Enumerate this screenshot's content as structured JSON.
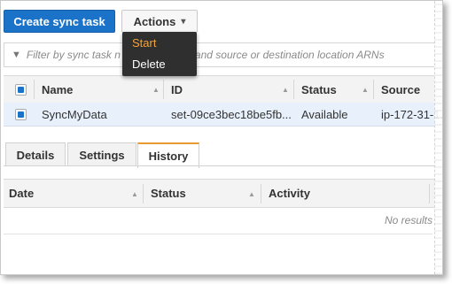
{
  "toolbar": {
    "create_label": "Create sync task",
    "actions_label": "Actions",
    "actions_chevron": "chevron-down-icon"
  },
  "actions_menu": {
    "items": [
      "Start",
      "Delete"
    ]
  },
  "filter": {
    "placeholder": "Filter by sync task name and source or destination location ARNs",
    "visible_left": "Filter by sync task n",
    "visible_right": "and source or destination location ARNs",
    "icon": "filter-icon"
  },
  "tasks_table": {
    "columns": [
      "Name",
      "ID",
      "Status",
      "Source"
    ],
    "rows": [
      {
        "selected": true,
        "name": "SyncMyData",
        "id": "set-09ce3bec18be5fb...",
        "status": "Available",
        "source": "ip-172-31-1..."
      }
    ]
  },
  "tabs": [
    {
      "label": "Details",
      "active": false
    },
    {
      "label": "Settings",
      "active": false
    },
    {
      "label": "History",
      "active": true
    }
  ],
  "history_table": {
    "columns": [
      "Date",
      "Status",
      "Activity"
    ],
    "empty_text": "No results"
  },
  "colors": {
    "primary": "#1a73c9",
    "menu_bg": "#2f2f2f",
    "menu_active": "#f2a33a",
    "tab_accent": "#e89b2f",
    "selected_row": "#e8f1fb"
  }
}
